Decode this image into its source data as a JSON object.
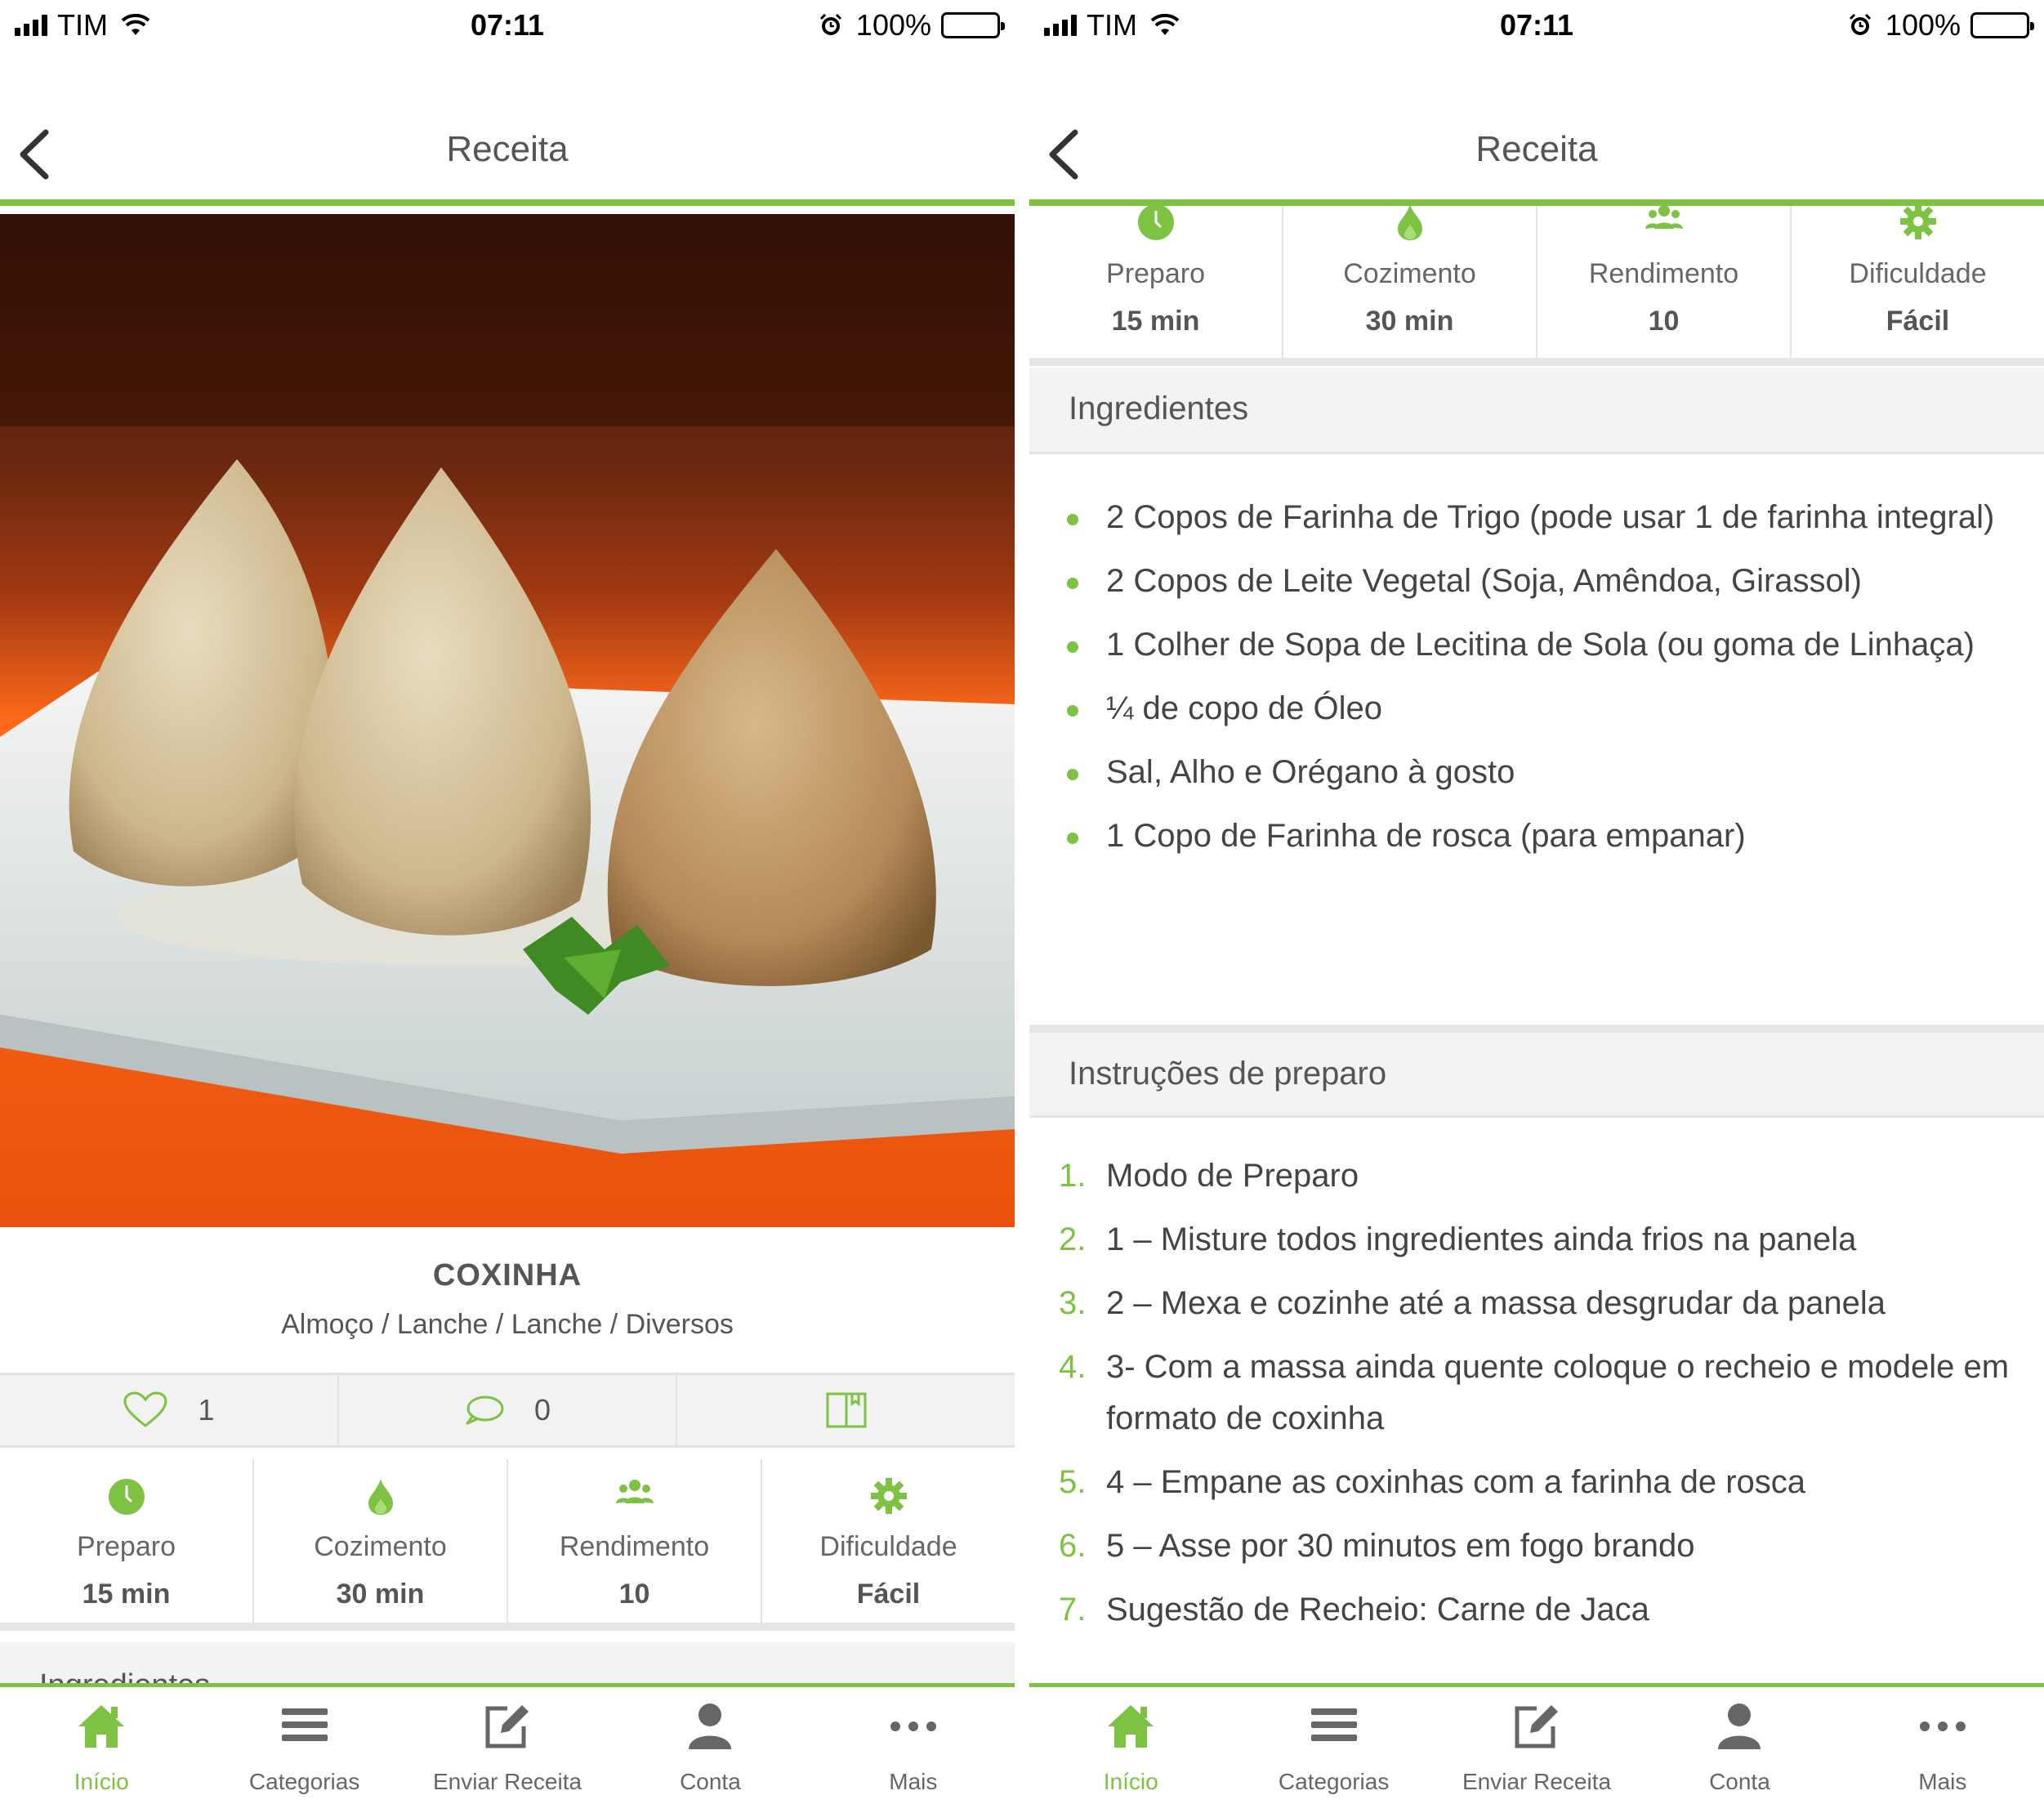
{
  "status_bar": {
    "carrier": "TIM",
    "time": "07:11",
    "battery": "100%"
  },
  "nav": {
    "title": "Receita"
  },
  "recipe": {
    "name": "COXINHA",
    "categories": "Almoço / Lanche / Lanche / Diversos",
    "likes": "1",
    "comments": "0"
  },
  "stats": [
    {
      "label": "Preparo",
      "value": "15 min",
      "icon": "clock-icon"
    },
    {
      "label": "Cozimento",
      "value": "30 min",
      "icon": "flame-icon"
    },
    {
      "label": "Rendimento",
      "value": "10",
      "icon": "people-icon"
    },
    {
      "label": "Dificuldade",
      "value": "Fácil",
      "icon": "gear-icon"
    }
  ],
  "ingredients": {
    "title": "Ingredientes",
    "peek_title": "Ingredientes",
    "items": [
      "2 Copos de Farinha de Trigo (pode usar 1 de farinha integral)",
      "2 Copos de Leite Vegetal (Soja, Amêndoa, Girassol)",
      "1 Colher de Sopa de Lecitina de Sola (ou goma de Linhaça)",
      "¼ de copo de Óleo",
      "Sal, Alho e Orégano à gosto",
      "1 Copo de Farinha de rosca (para empanar)"
    ]
  },
  "instructions": {
    "title": "Instruções de preparo",
    "items": [
      {
        "num": "1.",
        "text": "Modo de Preparo"
      },
      {
        "num": "2.",
        "text": "1 – Misture todos ingredientes ainda frios na panela"
      },
      {
        "num": "3.",
        "text": "2 – Mexa e cozinhe até a massa desgrudar da panela"
      },
      {
        "num": "4.",
        "text": "3- Com a massa ainda quente coloque o recheio e modele em formato de coxinha"
      },
      {
        "num": "5.",
        "text": "4 – Empane as coxinhas com a farinha de rosca"
      },
      {
        "num": "6.",
        "text": "5 – Asse por 30 minutos em fogo brando"
      },
      {
        "num": "7.",
        "text": "Sugestão de Recheio: Carne de Jaca"
      }
    ]
  },
  "tabbar": [
    {
      "label": "Início",
      "icon": "home-icon",
      "active": true
    },
    {
      "label": "Categorias",
      "icon": "menu-icon",
      "active": false
    },
    {
      "label": "Enviar Receita",
      "icon": "edit-icon",
      "active": false
    },
    {
      "label": "Conta",
      "icon": "user-icon",
      "active": false
    },
    {
      "label": "Mais",
      "icon": "more-icon",
      "active": false
    }
  ],
  "colors": {
    "accent": "#7dc242",
    "header_bg": "#f3f3f3"
  }
}
